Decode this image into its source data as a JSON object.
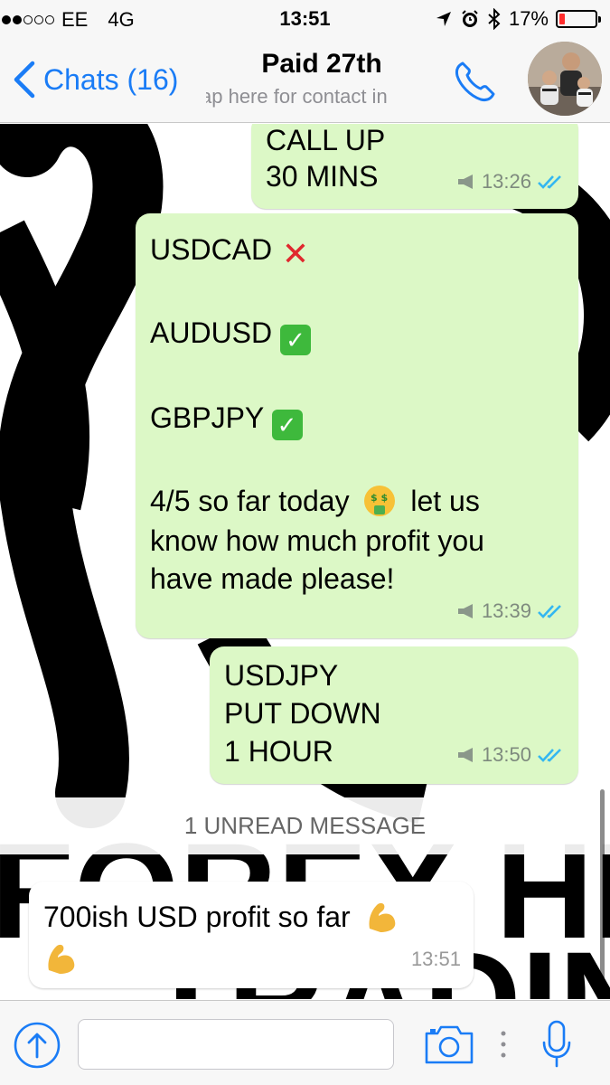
{
  "status_bar": {
    "carrier": "EE",
    "network": "4G",
    "time": "13:51",
    "battery": "17%",
    "battery_level": 0.17,
    "signal_bars": 2
  },
  "nav": {
    "back_label": "Chats (16)",
    "title": "Paid 27th",
    "subtitle": "ap here for contact in"
  },
  "messages": [
    {
      "direction": "out",
      "lines": [
        "CALL UP",
        "30 MINS"
      ],
      "time": "13:26"
    },
    {
      "direction": "out",
      "lines": [
        "USDCAD",
        "AUDUSD",
        "GBPJPY",
        "4/5 so far today",
        "let us",
        "know how much profit you",
        "have made please!"
      ],
      "time": "13:39"
    },
    {
      "direction": "out",
      "lines": [
        "USDJPY",
        "PUT DOWN",
        "1 HOUR"
      ],
      "time": "13:50"
    },
    {
      "direction": "in",
      "lines": [
        "700ish USD profit so far"
      ],
      "time": "13:51"
    }
  ],
  "unread_label": "1 UNREAD MESSAGE",
  "wallpaper": {
    "line1": "FOREX HELP",
    "line2": "TRADING"
  },
  "colors": {
    "accent": "#1a7cf6",
    "outgoing_bubble": "#dcf8c6",
    "read_ticks": "#34b7f1",
    "battery_low": "#ff2d2d"
  },
  "icons": {
    "location": "location-arrow-icon",
    "alarm": "alarm-icon",
    "bluetooth": "bluetooth-icon",
    "call": "phone-icon",
    "attach": "share-arrow-icon",
    "camera": "camera-icon",
    "mic": "microphone-icon",
    "money_face": "money-mouth-face-emoji",
    "flex": "flexed-biceps-emoji"
  }
}
